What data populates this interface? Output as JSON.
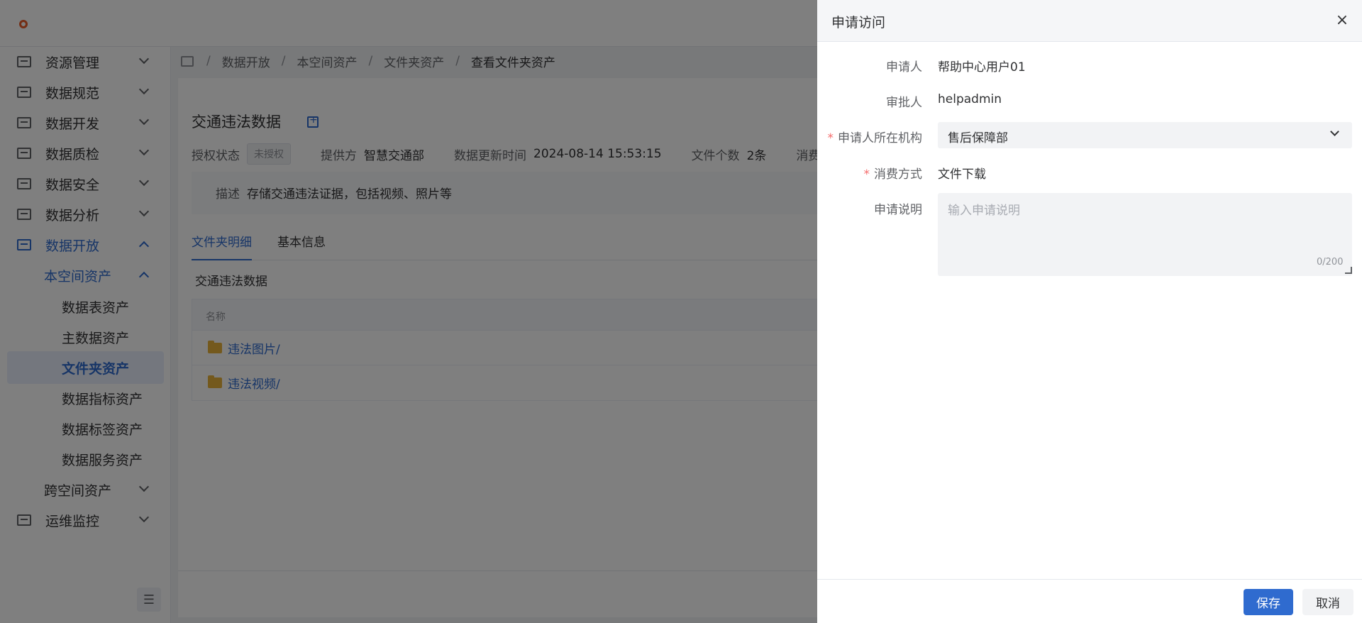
{
  "sidebar": {
    "menus": [
      {
        "label": "资源管理",
        "icon": "resource-icon"
      },
      {
        "label": "数据规范",
        "icon": "standard-icon"
      },
      {
        "label": "数据开发",
        "icon": "develop-icon"
      },
      {
        "label": "数据质检",
        "icon": "quality-icon"
      },
      {
        "label": "数据安全",
        "icon": "security-icon"
      },
      {
        "label": "数据分析",
        "icon": "analysis-icon"
      },
      {
        "label": "数据开放",
        "icon": "open-icon"
      }
    ],
    "submenu_parent": "本空间资产",
    "subitems": [
      "数据表资产",
      "主数据资产",
      "文件夹资产",
      "数据指标资产",
      "数据标签资产",
      "数据服务资产"
    ],
    "cross_space": "跨空间资产",
    "ops": "运维监控",
    "collapse_icon": "collapse-icon"
  },
  "breadcrumb": [
    "数据开放",
    "本空间资产",
    "文件夹资产",
    "查看文件夹资产"
  ],
  "asset": {
    "title": "交通违法数据",
    "auth_label": "授权状态",
    "auth_status": "未授权",
    "provider_label": "提供方",
    "provider": "智慧交通部",
    "updated_label": "数据更新时间",
    "updated": "2024-08-14 15:53:15",
    "file_count_label": "文件个数",
    "file_count": "2条",
    "consume_label": "消费",
    "desc_label": "描述",
    "desc": "存储交通违法证据，包括视频、照片等"
  },
  "tabs": [
    "文件夹明细",
    "基本信息"
  ],
  "folder": {
    "title": "交通违法数据",
    "column": "名称",
    "rows": [
      "违法图片/",
      "违法视频/"
    ]
  },
  "drawer": {
    "title": "申请访问",
    "close": "×",
    "fields": {
      "applicant_label": "申请人",
      "applicant": "帮助中心用户01",
      "approver_label": "审批人",
      "approver": "helpadmin",
      "org_label": "申请人所在机构",
      "org": "售后保障部",
      "consume_label": "消费方式",
      "consume": "文件下载",
      "note_label": "申请说明",
      "note_placeholder": "输入申请说明",
      "note_counter": "0/200"
    },
    "save": "保存",
    "cancel": "取消",
    "required_mark": "*"
  }
}
